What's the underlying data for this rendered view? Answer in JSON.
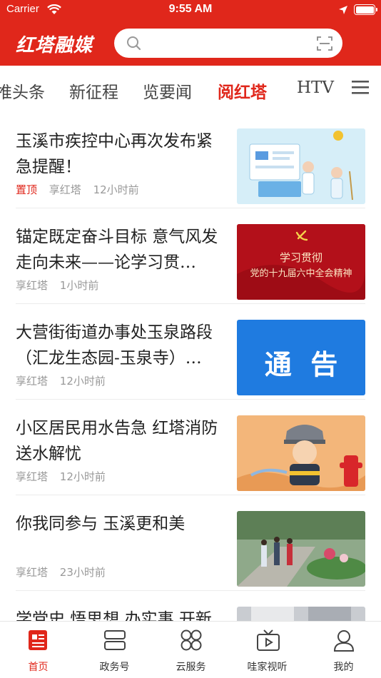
{
  "status_bar": {
    "carrier": "Carrier",
    "time": "9:55 AM"
  },
  "header": {
    "logo_text": "红塔融媒",
    "search_placeholder": ""
  },
  "tabs": [
    {
      "label": "推头条",
      "active": false
    },
    {
      "label": "新征程",
      "active": false
    },
    {
      "label": "览要闻",
      "active": false
    },
    {
      "label": "阅红塔",
      "active": true
    },
    {
      "label": "HTV",
      "active": false
    }
  ],
  "news": [
    {
      "title": "玉溪市疾控中心再次发布紧急提醒！",
      "pin": "置顶",
      "source": "享红塔",
      "time": "12小时前"
    },
    {
      "title": "锚定既定奋斗目标 意气风发走向未来——论学习贯…",
      "pin": "",
      "source": "享红塔",
      "time": "1小时前",
      "thumb_text_1": "学习贯彻",
      "thumb_text_2": "党的十九届六中全会精神"
    },
    {
      "title": "大营街街道办事处玉泉路段（汇龙生态园-玉泉寺）…",
      "pin": "",
      "source": "享红塔",
      "time": "12小时前",
      "thumb_text": "通  告"
    },
    {
      "title": "小区居民用水告急 红塔消防送水解忧",
      "pin": "",
      "source": "享红塔",
      "time": "12小时前"
    },
    {
      "title": "你我同参与 玉溪更和美",
      "pin": "",
      "source": "享红塔",
      "time": "23小时前"
    },
    {
      "title": "学党史 悟思想 办实事 开新",
      "pin": "",
      "source": "",
      "time": ""
    }
  ],
  "bottom_nav": [
    {
      "label": "首页",
      "icon": "home-news-icon",
      "active": true
    },
    {
      "label": "政务号",
      "icon": "government-icon",
      "active": false
    },
    {
      "label": "云服务",
      "icon": "cloud-service-icon",
      "active": false
    },
    {
      "label": "哇家视听",
      "icon": "tv-icon",
      "active": false
    },
    {
      "label": "我的",
      "icon": "profile-icon",
      "active": false
    }
  ],
  "colors": {
    "brand_red": "#e0271b",
    "meta_gray": "#999999",
    "notice_blue": "#1f7be0"
  }
}
